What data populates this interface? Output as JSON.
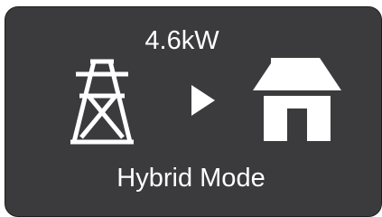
{
  "energy_flow": {
    "power_value": "4.6kW",
    "mode_label": "Hybrid Mode",
    "source_icon": "transmission-tower-icon",
    "direction_icon": "play-arrow-icon",
    "destination_icon": "home-icon"
  },
  "colors": {
    "card_background": "#3b3a3c",
    "foreground": "#ffffff"
  }
}
